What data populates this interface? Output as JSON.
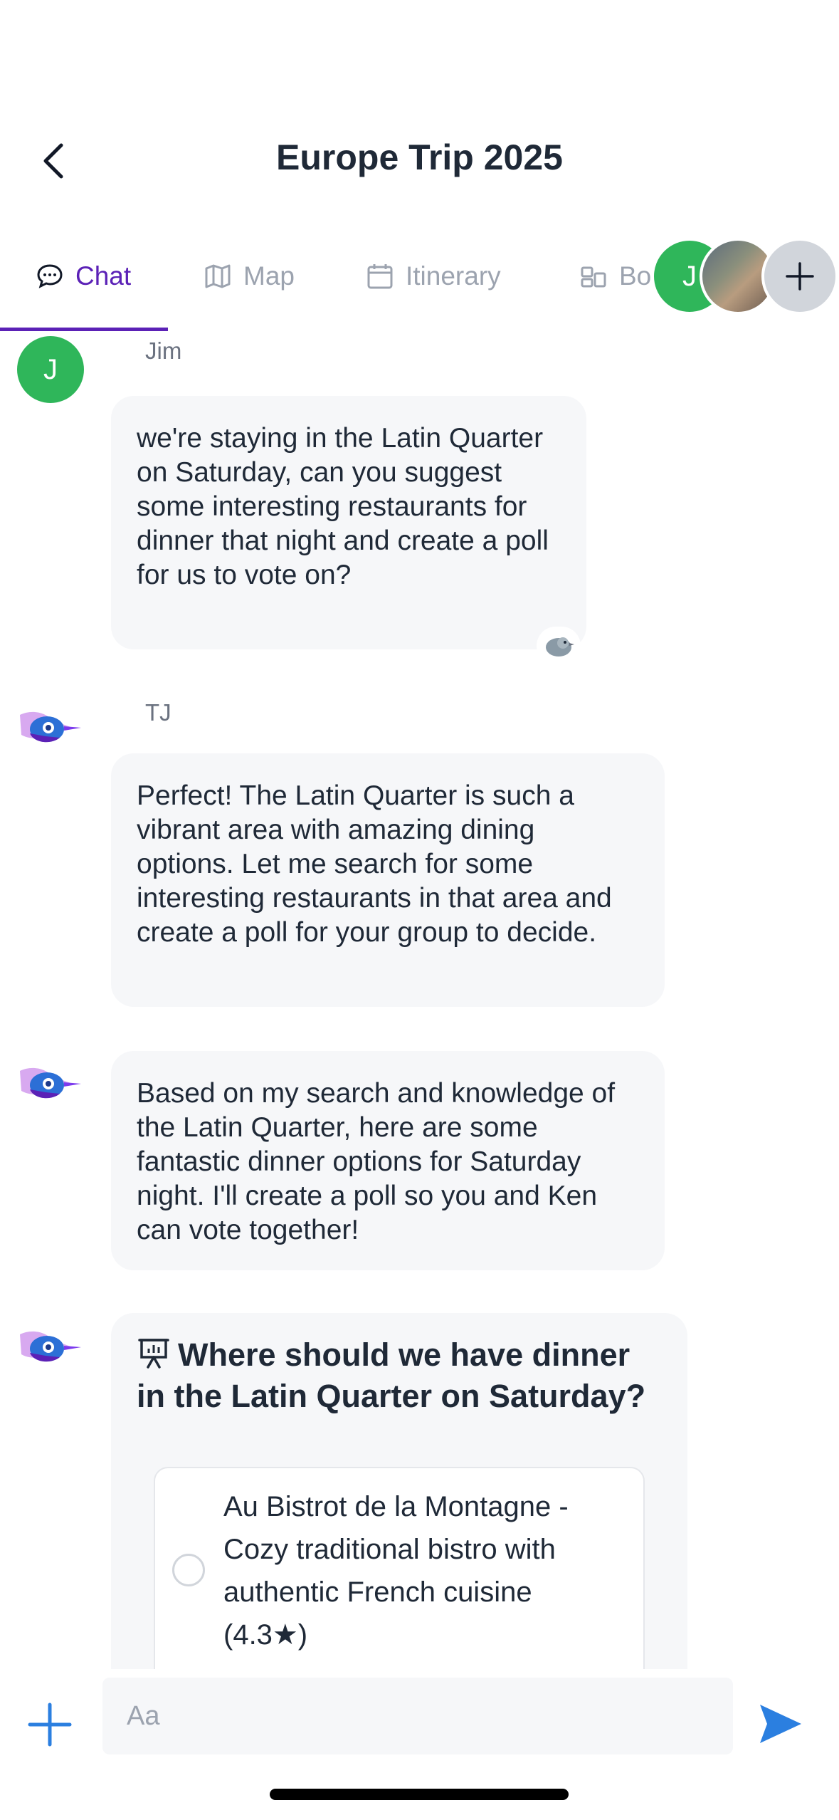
{
  "header": {
    "title": "Europe Trip 2025"
  },
  "tabs": [
    {
      "label": "Chat",
      "icon": "chat-bubble-icon",
      "active": true
    },
    {
      "label": "Map",
      "icon": "map-icon",
      "active": false
    },
    {
      "label": "Itinerary",
      "icon": "calendar-icon",
      "active": false
    },
    {
      "label": "Bo",
      "icon": "board-icon",
      "active": false
    }
  ],
  "avatars": {
    "initial": "J"
  },
  "messages": [
    {
      "sender": "Jim",
      "avatar_initial": "J",
      "text": "we're staying in the Latin Quarter on Saturday, can you suggest some interesting restaurants for dinner that night and create a poll for us to vote on?",
      "reaction_icon": "bird-reaction-icon"
    },
    {
      "sender": "TJ",
      "text": "Perfect! The Latin Quarter is such a vibrant area with amazing dining options. Let me search for some interesting restaurants in that area and create a poll for your group to decide."
    },
    {
      "sender": "",
      "text": "Based on my search and knowledge of the Latin Quarter, here are some fantastic dinner options for Saturday night. I'll create a poll so you and Ken can vote together!"
    }
  ],
  "poll": {
    "title": "Where should we have dinner in the Latin Quarter on Saturday?",
    "options": [
      {
        "label": "Au Bistrot de la Montagne - Cozy traditional bistro with authentic French cuisine (4.3★)"
      }
    ]
  },
  "composer": {
    "placeholder": "Aa"
  },
  "colors": {
    "accent": "#5b21b6",
    "avatar_green": "#2fb65a",
    "send_blue": "#2b7fe0",
    "bubble_bg": "#f6f7f9"
  }
}
